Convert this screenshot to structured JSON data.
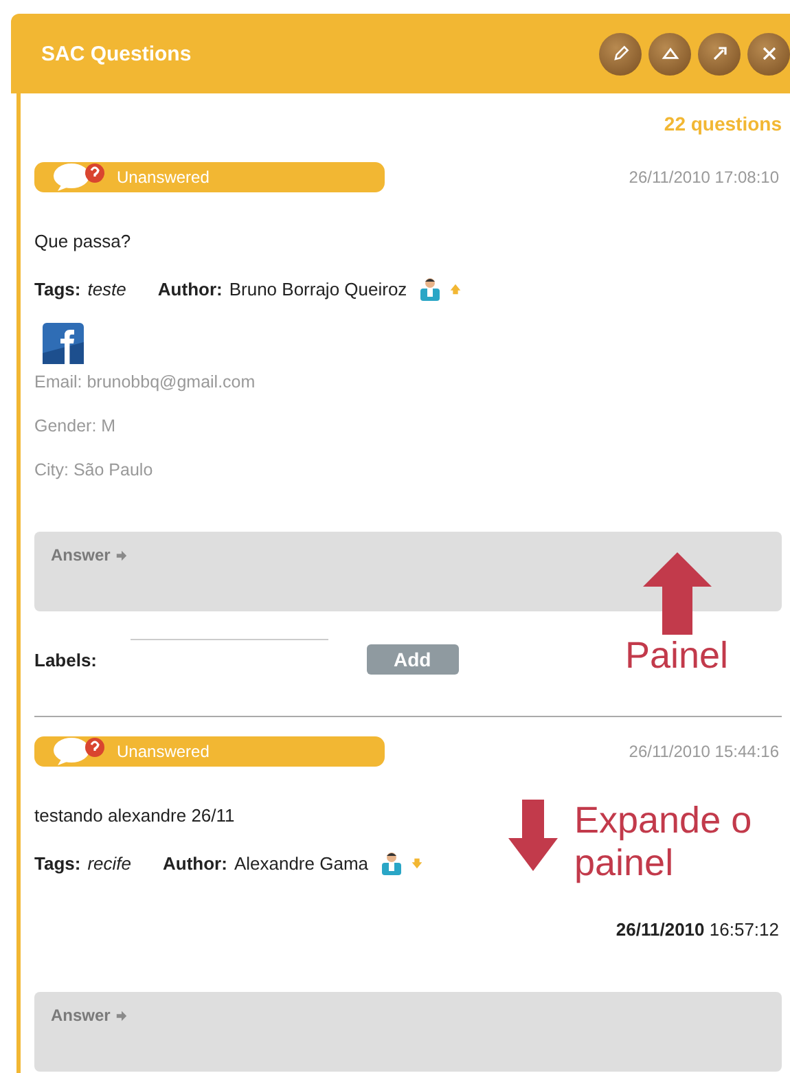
{
  "window": {
    "title": "SAC Questions"
  },
  "toolbar": [
    {
      "kind": "edit"
    },
    {
      "kind": "collapse"
    },
    {
      "kind": "popout"
    },
    {
      "kind": "close"
    }
  ],
  "count": "22 questions",
  "questions": [
    {
      "status": "Unanswered",
      "date": "26/11/2010 17:08:10",
      "text": "Que passa?",
      "tags_label": "Tags:",
      "tag": "teste",
      "author_label": "Author:",
      "author": "Bruno Borrajo Queiroz",
      "expanded": true,
      "profile": [
        {
          "label": "Email:",
          "value": "brunobbq@gmail.com"
        },
        {
          "label": "Gender:",
          "value": "M"
        },
        {
          "label": "City:",
          "value": "São Paulo"
        }
      ],
      "answer_label": "Answer",
      "labels_label": "Labels:",
      "add_button": "Add"
    },
    {
      "status": "Unanswered",
      "date": "26/11/2010 15:44:16",
      "text": "testando alexandre 26/11",
      "tags_label": "Tags:",
      "tag": "recife",
      "author_label": "Author:",
      "author": "Alexandre Gama",
      "expanded": false,
      "answered_at": "**26/11/2010** 16:57:12",
      "answer_label": "Answer"
    }
  ],
  "annotations": [
    {
      "text": "Painel",
      "kind": "arrow_up"
    },
    {
      "text": "Expande o painel",
      "kind": "arrow_down"
    }
  ]
}
